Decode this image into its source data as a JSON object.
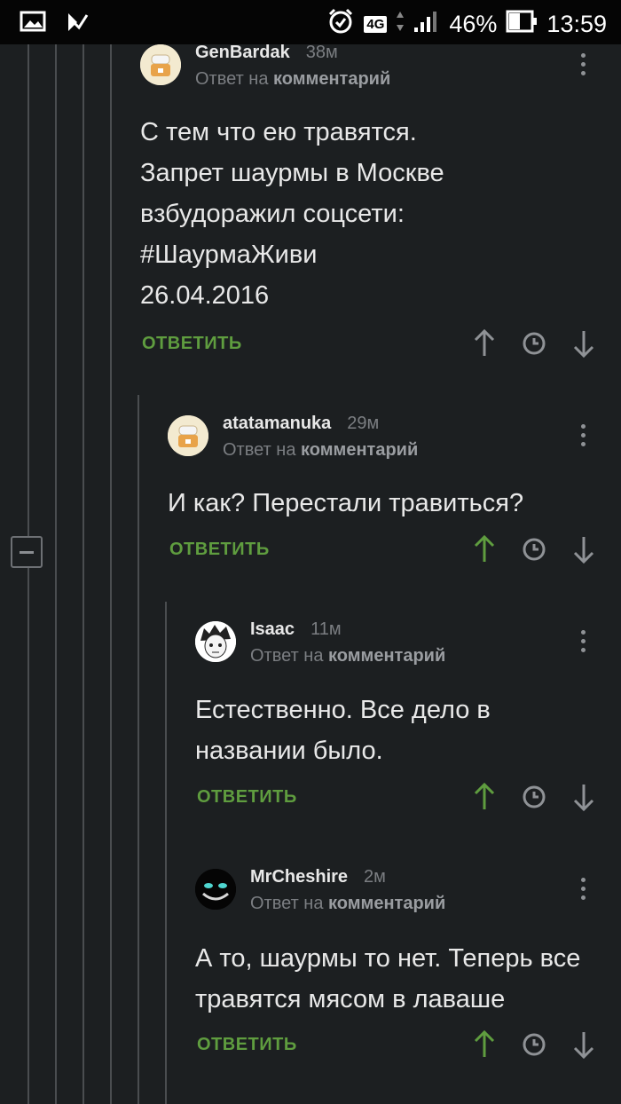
{
  "status_bar": {
    "network": "4G",
    "battery": "46%",
    "time": "13:59"
  },
  "comments": [
    {
      "username": "GenBardak",
      "time": "38м",
      "reply_prefix": "Ответ на",
      "reply_link": "комментарий",
      "body": "С тем что ею травятся.\nЗапрет шаурмы в Москве взбудоражил соцсети: #ШаурмаЖиви\n26.04.2016",
      "reply_label": "ОТВЕТИТЬ",
      "upvoted": false
    },
    {
      "username": "atatamanuka",
      "time": "29м",
      "reply_prefix": "Ответ на",
      "reply_link": "комментарий",
      "body": "И как? Перестали травиться?",
      "reply_label": "ОТВЕТИТЬ",
      "upvoted": true
    },
    {
      "username": "Isaac",
      "time": "11м",
      "reply_prefix": "Ответ на",
      "reply_link": "комментарий",
      "body": "Естественно. Все дело в названии было.",
      "reply_label": "ОТВЕТИТЬ",
      "upvoted": true
    },
    {
      "username": "MrCheshire",
      "time": "2м",
      "reply_prefix": "Ответ на",
      "reply_link": "комментарий",
      "body": "А то, шаурмы то нет. Теперь все травятся мясом в лаваше",
      "reply_label": "ОТВЕТИТЬ",
      "upvoted": true
    }
  ],
  "colors": {
    "background": "#1c1f21",
    "accent_green": "#5f9d3f",
    "muted": "#7b7e82"
  }
}
